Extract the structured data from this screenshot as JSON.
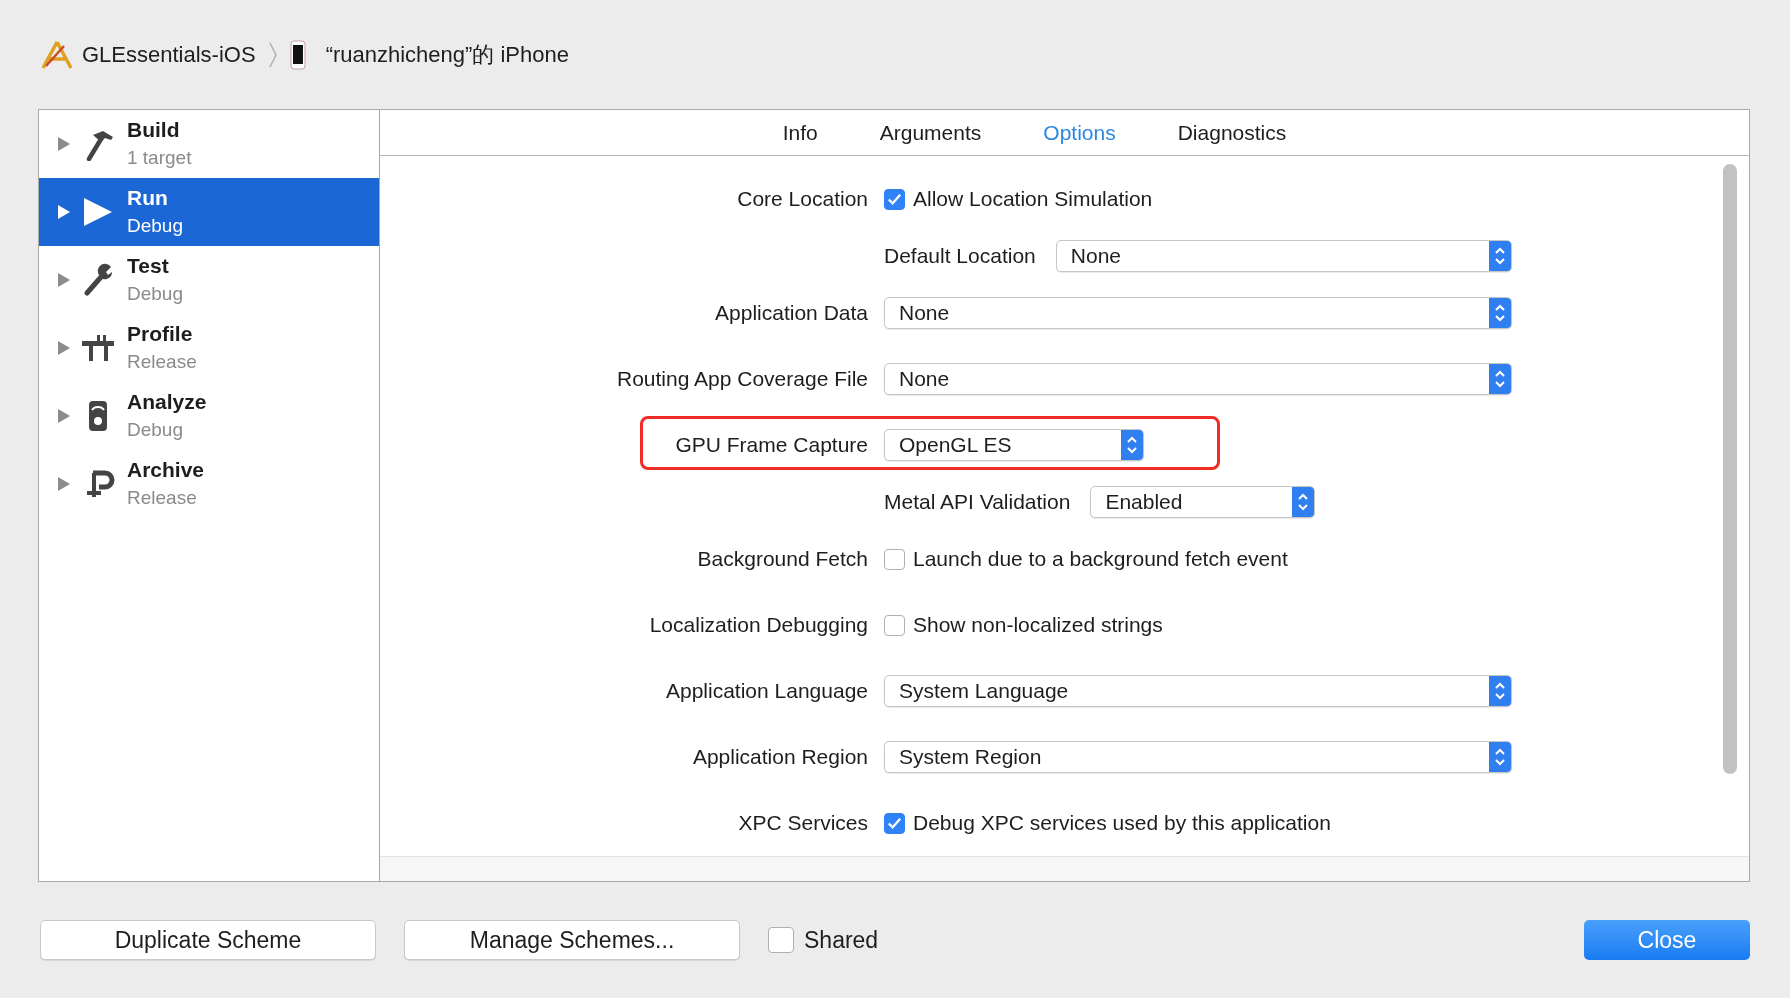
{
  "breadcrumb": {
    "project": "GLEssentials-iOS",
    "device": "“ruanzhicheng”的 iPhone"
  },
  "schemes": [
    {
      "kind": "build",
      "title": "Build",
      "subtitle": "1 target",
      "selected": false
    },
    {
      "kind": "run",
      "title": "Run",
      "subtitle": "Debug",
      "selected": true
    },
    {
      "kind": "test",
      "title": "Test",
      "subtitle": "Debug",
      "selected": false
    },
    {
      "kind": "profile",
      "title": "Profile",
      "subtitle": "Release",
      "selected": false
    },
    {
      "kind": "analyze",
      "title": "Analyze",
      "subtitle": "Debug",
      "selected": false
    },
    {
      "kind": "archive",
      "title": "Archive",
      "subtitle": "Release",
      "selected": false
    }
  ],
  "tabs": [
    {
      "label": "Info",
      "selected": false
    },
    {
      "label": "Arguments",
      "selected": false
    },
    {
      "label": "Options",
      "selected": true
    },
    {
      "label": "Diagnostics",
      "selected": false
    }
  ],
  "options": [
    {
      "kind": "checkbox",
      "label": "Core Location",
      "text": "Allow Location Simulation",
      "checked": true,
      "highlighted": false
    },
    {
      "kind": "sub-popup",
      "label": "Default Location",
      "value": "None",
      "compact": false,
      "highlighted": false
    },
    {
      "kind": "popup",
      "label": "Application Data",
      "value": "None",
      "compact": false,
      "highlighted": false
    },
    {
      "kind": "popup",
      "label": "Routing App Coverage File",
      "value": "None",
      "compact": false,
      "highlighted": false
    },
    {
      "kind": "popup",
      "label": "GPU Frame Capture",
      "value": "OpenGL ES",
      "compact": true,
      "highlighted": true
    },
    {
      "kind": "sub-popup",
      "label": "Metal API Validation",
      "value": "Enabled",
      "compact": true,
      "highlighted": false
    },
    {
      "kind": "checkbox",
      "label": "Background Fetch",
      "text": "Launch due to a background fetch event",
      "checked": false,
      "highlighted": false
    },
    {
      "kind": "checkbox",
      "label": "Localization Debugging",
      "text": "Show non-localized strings",
      "checked": false,
      "highlighted": false
    },
    {
      "kind": "popup",
      "label": "Application Language",
      "value": "System Language",
      "compact": false,
      "highlighted": false
    },
    {
      "kind": "popup",
      "label": "Application Region",
      "value": "System Region",
      "compact": false,
      "highlighted": false
    },
    {
      "kind": "checkbox",
      "label": "XPC Services",
      "text": "Debug XPC services used by this application",
      "checked": true,
      "highlighted": false
    }
  ],
  "footer": {
    "duplicate": "Duplicate Scheme",
    "manage": "Manage Schemes...",
    "shared": {
      "label": "Shared",
      "checked": false
    },
    "close": "Close"
  }
}
